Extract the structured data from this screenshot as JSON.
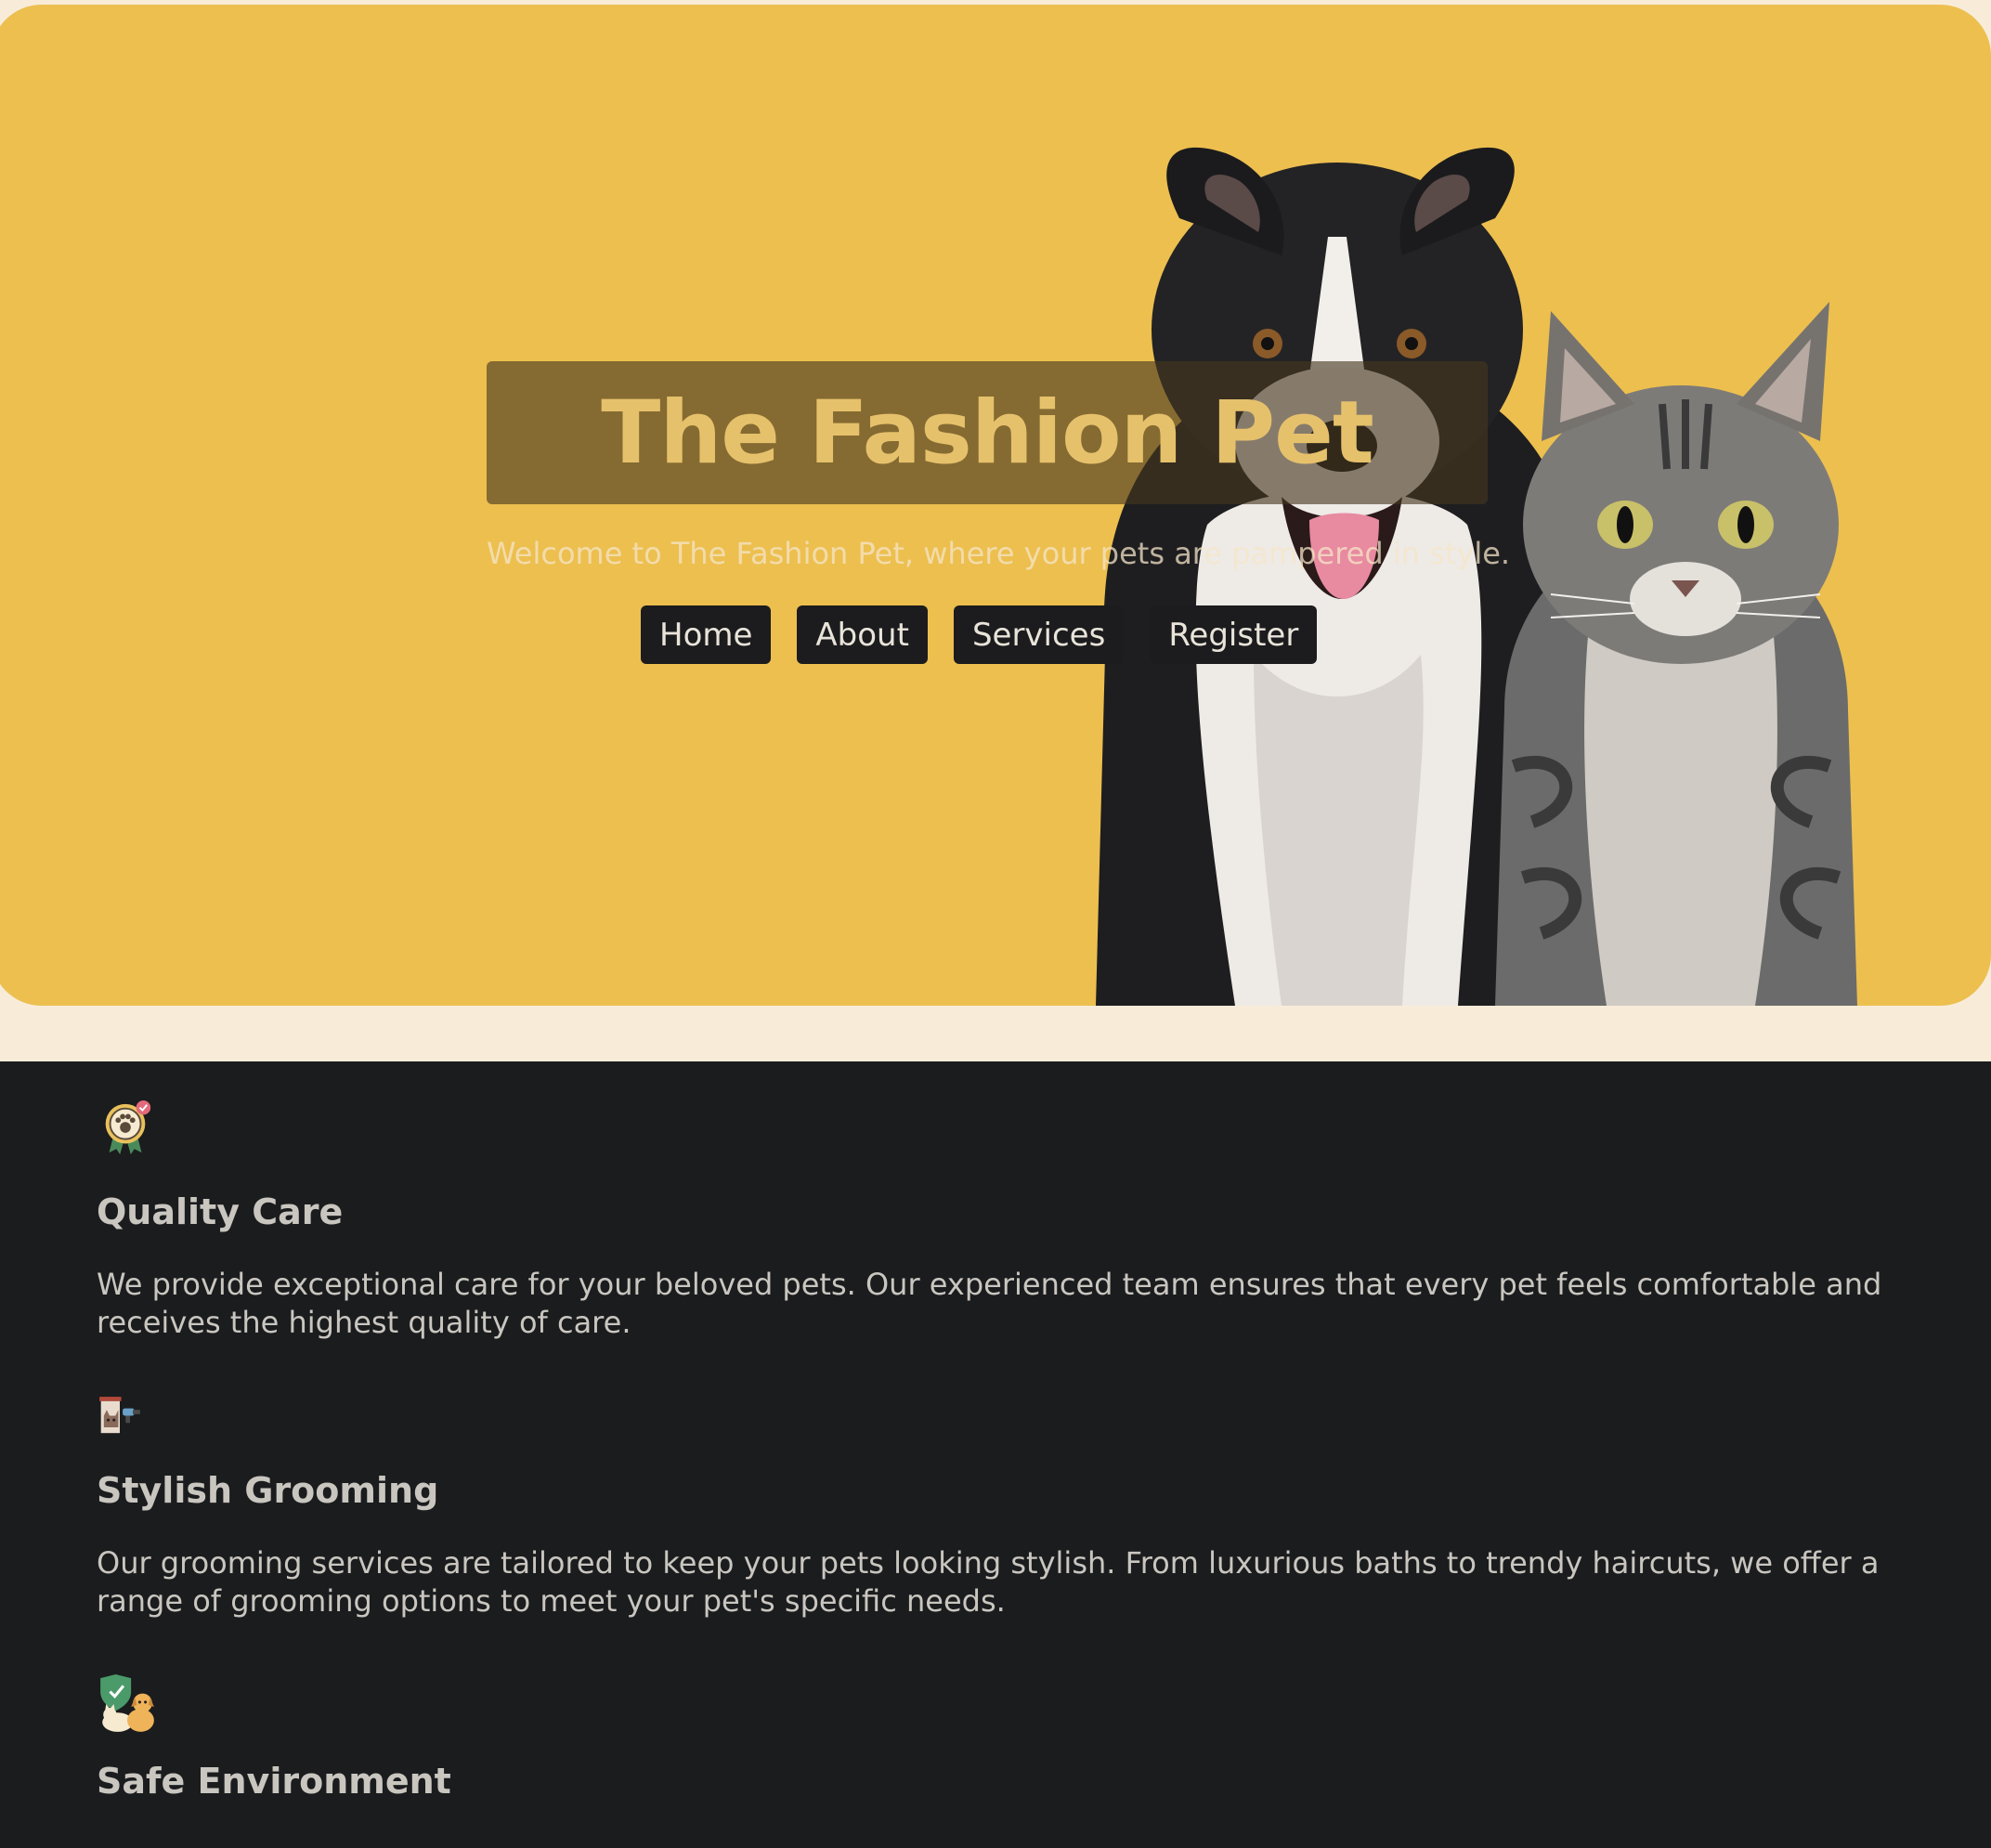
{
  "hero": {
    "title": "The Fashion Pet",
    "tagline": "Welcome to The Fashion Pet, where your pets are pampered in style.",
    "background_color": "#ecbf4f",
    "image_subject": "border-collie-and-tabby-cat"
  },
  "nav": {
    "items": [
      {
        "label": "Home"
      },
      {
        "label": "About"
      },
      {
        "label": "Services"
      },
      {
        "label": "Register"
      }
    ]
  },
  "features": [
    {
      "icon": "paw-award-badge-icon",
      "title": "Quality Care",
      "description": "We provide exceptional care for your beloved pets. Our experienced team ensures that every pet feels comfortable and receives the highest quality of care."
    },
    {
      "icon": "grooming-dryer-icon",
      "title": "Stylish Grooming",
      "description": "Our grooming services are tailored to keep your pets looking stylish. From luxurious baths to trendy haircuts, we offer a range of grooming options to meet your pet's specific needs."
    },
    {
      "icon": "shield-pets-icon",
      "title": "Safe Environment",
      "description": ""
    }
  ],
  "colors": {
    "page_background": "#f8ecd9",
    "features_background": "#1b1c1e",
    "nav_button": "#1c1c1e"
  }
}
